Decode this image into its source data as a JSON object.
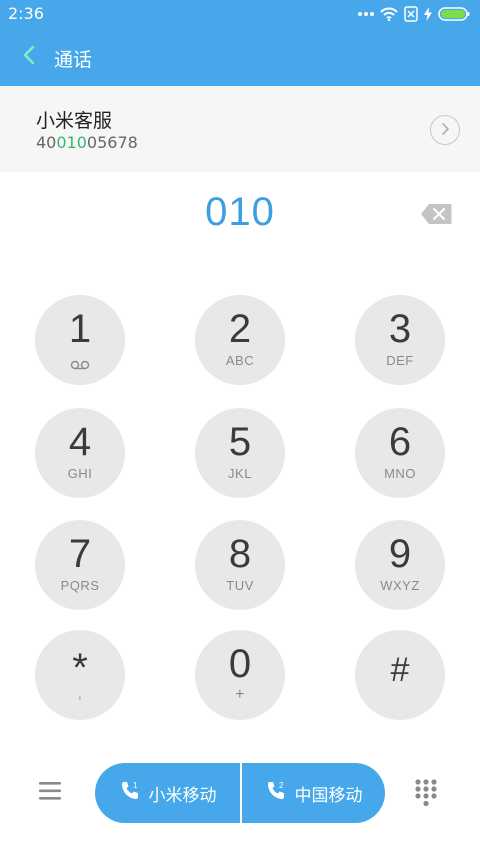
{
  "status_bar": {
    "time": "2:36",
    "icons": [
      "more-dots-icon",
      "wifi-icon",
      "no-sim-icon",
      "charging-bolt-icon",
      "battery-icon"
    ]
  },
  "header": {
    "back_icon": "chevron-left-icon",
    "title": "通话"
  },
  "contact_suggestion": {
    "name": "小米客服",
    "number_prefix": "40",
    "number_match": "010",
    "number_suffix": "05678",
    "arrow_icon": "chevron-right-circle-icon",
    "highlight_color": "#37b76b"
  },
  "dialed": {
    "number": "010",
    "backspace_icon": "backspace-icon"
  },
  "keypad": [
    {
      "digit": "1",
      "letters": "",
      "sub_icon": "voicemail-icon"
    },
    {
      "digit": "2",
      "letters": "ABC"
    },
    {
      "digit": "3",
      "letters": "DEF"
    },
    {
      "digit": "4",
      "letters": "GHI"
    },
    {
      "digit": "5",
      "letters": "JKL"
    },
    {
      "digit": "6",
      "letters": "MNO"
    },
    {
      "digit": "7",
      "letters": "PQRS"
    },
    {
      "digit": "8",
      "letters": "TUV"
    },
    {
      "digit": "9",
      "letters": "WXYZ"
    },
    {
      "digit": "*",
      "letters": ","
    },
    {
      "digit": "0",
      "letters": "+"
    },
    {
      "digit": "#",
      "letters": ""
    }
  ],
  "bottom_bar": {
    "menu_icon": "hamburger-menu-icon",
    "sim1": {
      "label": "小米移动",
      "icon": "phone-sim1-icon",
      "sim_number": "1"
    },
    "sim2": {
      "label": "中国移动",
      "icon": "phone-sim2-icon",
      "sim_number": "2"
    },
    "dialpad_icon": "dialpad-grid-icon"
  },
  "colors": {
    "accent": "#46a8ea",
    "digit_text": "#3d9ee0",
    "key_background": "#e8e8e8"
  }
}
